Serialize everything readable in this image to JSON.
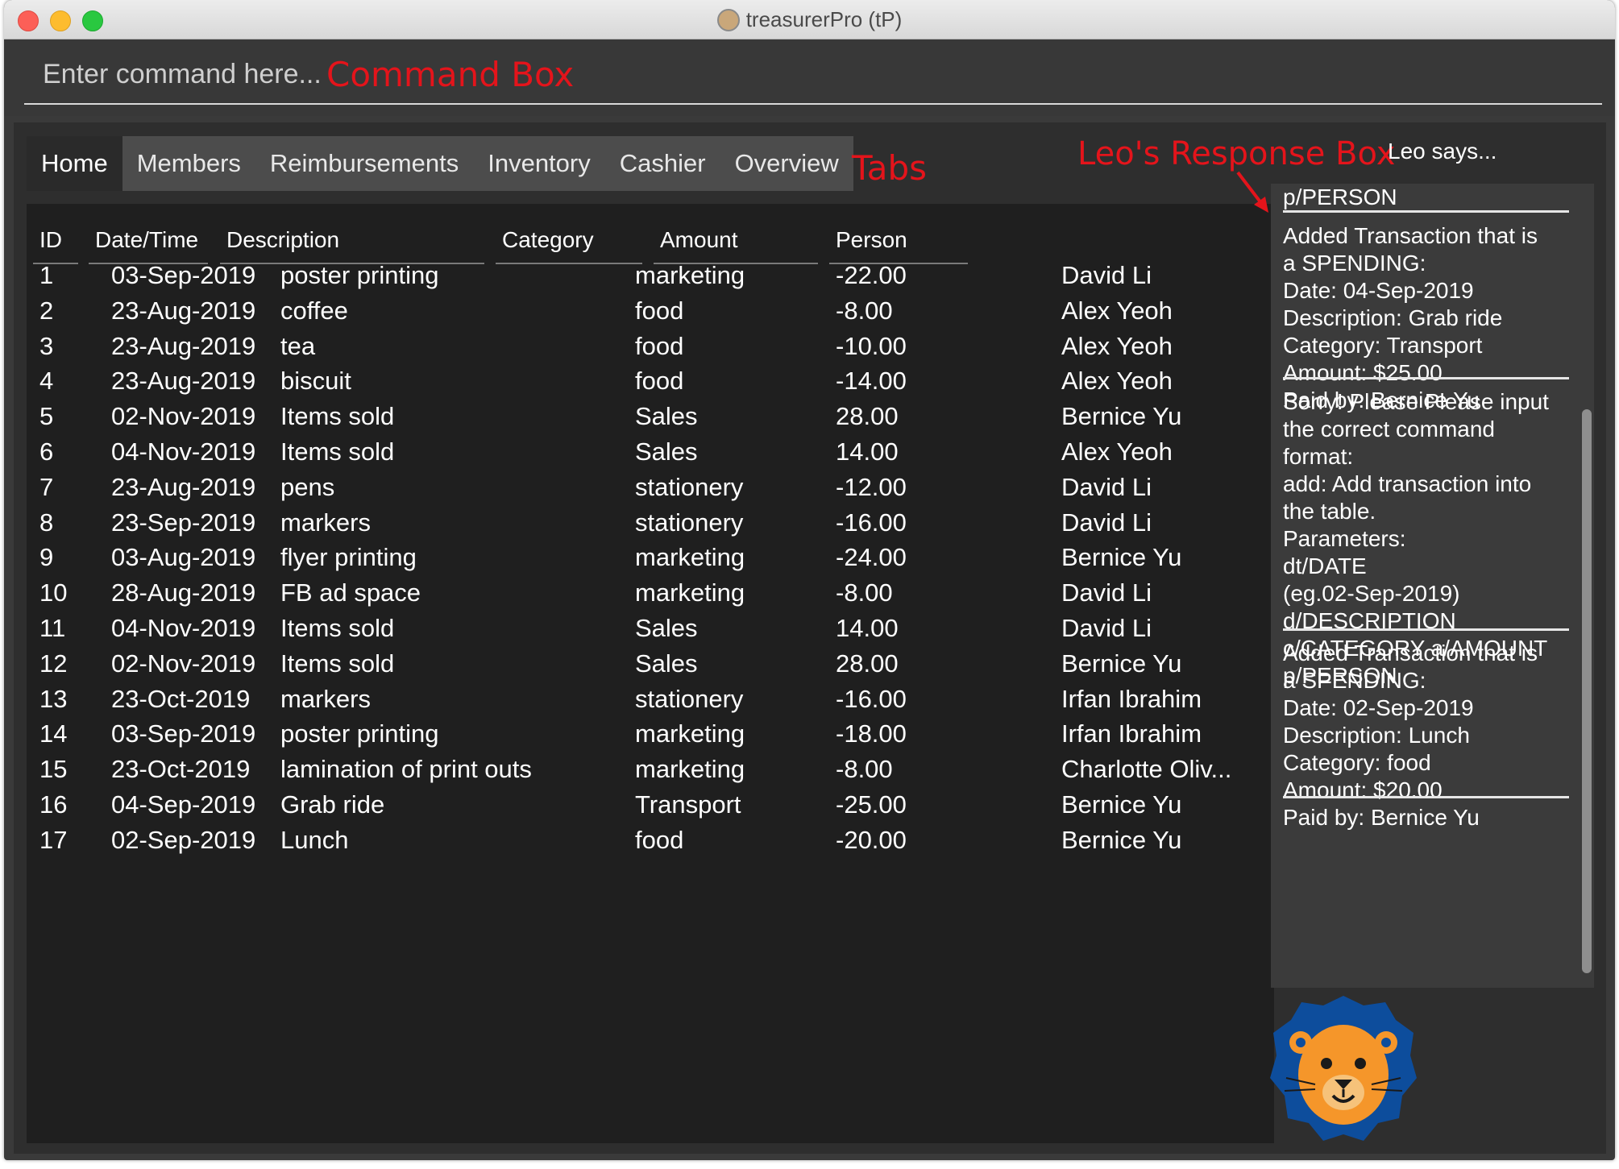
{
  "window": {
    "title": "treasurerPro (tP)"
  },
  "command": {
    "placeholder": "Enter command here...",
    "annotation": "Command Box"
  },
  "tabs": [
    {
      "label": "Home",
      "active": true
    },
    {
      "label": "Members"
    },
    {
      "label": "Reimbursements"
    },
    {
      "label": "Inventory"
    },
    {
      "label": "Cashier"
    },
    {
      "label": "Overview"
    }
  ],
  "tabs_annotation": "Tabs",
  "table": {
    "headers": [
      "ID",
      "Date/Time",
      "Description",
      "Category",
      "Amount",
      "Person"
    ],
    "rows": [
      [
        "1",
        "03-Sep-2019",
        "poster printing",
        "marketing",
        "-22.00",
        "David Li"
      ],
      [
        "2",
        "23-Aug-2019",
        "coffee",
        "food",
        "-8.00",
        "Alex Yeoh"
      ],
      [
        "3",
        "23-Aug-2019",
        "tea",
        "food",
        "-10.00",
        "Alex Yeoh"
      ],
      [
        "4",
        "23-Aug-2019",
        "biscuit",
        "food",
        "-14.00",
        "Alex Yeoh"
      ],
      [
        "5",
        "02-Nov-2019",
        "Items sold",
        "Sales",
        "28.00",
        "Bernice Yu"
      ],
      [
        "6",
        "04-Nov-2019",
        "Items sold",
        "Sales",
        "14.00",
        "Alex Yeoh"
      ],
      [
        "7",
        "23-Aug-2019",
        "pens",
        "stationery",
        "-12.00",
        "David Li"
      ],
      [
        "8",
        "23-Sep-2019",
        "markers",
        "stationery",
        "-16.00",
        "David Li"
      ],
      [
        "9",
        "03-Aug-2019",
        "flyer printing",
        "marketing",
        "-24.00",
        "Bernice Yu"
      ],
      [
        "10",
        "28-Aug-2019",
        "FB ad space",
        "marketing",
        "-8.00",
        "David Li"
      ],
      [
        "11",
        "04-Nov-2019",
        "Items sold",
        "Sales",
        "14.00",
        "David Li"
      ],
      [
        "12",
        "02-Nov-2019",
        "Items sold",
        "Sales",
        "28.00",
        "Bernice Yu"
      ],
      [
        "13",
        "23-Oct-2019",
        "markers",
        "stationery",
        "-16.00",
        "Irfan Ibrahim"
      ],
      [
        "14",
        "03-Sep-2019",
        "poster printing",
        "marketing",
        "-18.00",
        "Irfan Ibrahim"
      ],
      [
        "15",
        "23-Oct-2019",
        "lamination of print outs",
        "marketing",
        "-8.00",
        "Charlotte Oliv..."
      ],
      [
        "16",
        "04-Sep-2019",
        "Grab ride",
        "Transport",
        "-25.00",
        "Bernice Yu"
      ],
      [
        "17",
        "02-Sep-2019",
        "Lunch",
        "food",
        "-20.00",
        "Bernice Yu"
      ]
    ]
  },
  "response": {
    "annotation": "Leo's Response Box",
    "header": "Leo says...",
    "messages": [
      "p/PERSON",
      "Added Transaction that is\na SPENDING:\nDate: 04-Sep-2019\nDescription: Grab ride\nCategory: Transport\nAmount: $25.00\nPaid by: Bernice Yu",
      "Sorry! Please Please input\nthe correct command\nformat:\nadd: Add transaction into\nthe table.\nParameters:\ndt/DATE\n(eg.02-Sep-2019)\nd/DESCRIPTION\nc/CATEGORY a/AMOUNT\np/PERSON",
      "Added Transaction that is\na SPENDING:\nDate: 02-Sep-2019\nDescription: Lunch\nCategory: food\nAmount: $20.00\nPaid by: Bernice Yu"
    ]
  },
  "colors": {
    "annotation": "#e4141b",
    "background": "#2e2e2e",
    "table_bg": "#1f1f1f",
    "mascot_mane": "#0d4d9c",
    "mascot_face": "#f5962a"
  },
  "icons": [
    "app-lion-icon",
    "close-icon",
    "minimize-icon",
    "maximize-icon",
    "arrow-icon",
    "leo-lion-mascot-icon"
  ]
}
